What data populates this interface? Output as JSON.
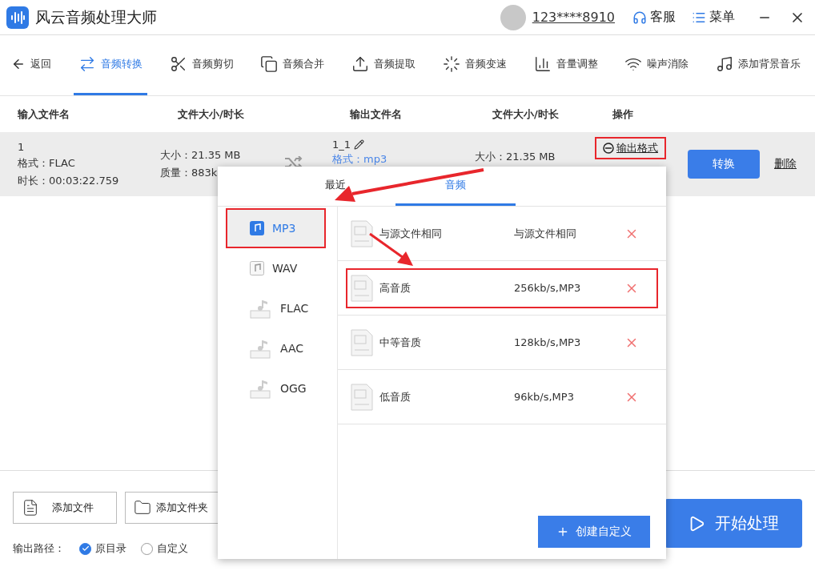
{
  "app": {
    "title": "风云音频处理大师",
    "user": "123****8910",
    "service": "客服",
    "menu": "菜单"
  },
  "nav": {
    "back": "返回",
    "tools": [
      {
        "label": "音频转换",
        "selected": true,
        "kind": "convert"
      },
      {
        "label": "音频剪切",
        "selected": false,
        "kind": "cut"
      },
      {
        "label": "音频合并",
        "selected": false,
        "kind": "merge"
      },
      {
        "label": "音频提取",
        "selected": false,
        "kind": "extract"
      },
      {
        "label": "音频变速",
        "selected": false,
        "kind": "speed"
      },
      {
        "label": "音量调整",
        "selected": false,
        "kind": "volume"
      },
      {
        "label": "噪声消除",
        "selected": false,
        "kind": "noise"
      },
      {
        "label": "添加背景音乐",
        "selected": false,
        "kind": "music"
      }
    ]
  },
  "table": {
    "columns": [
      "输入文件名",
      "文件大小/时长",
      "输出文件名",
      "文件大小/时长",
      "操作"
    ],
    "rows": [
      {
        "name": "1",
        "format": "格式：FLAC",
        "duration": "时长：00:03:22.759",
        "size": "大小：21.35 MB",
        "quality": "质量：883k",
        "output_name": "1_1",
        "output_format": "格式：mp3",
        "output_size": "大小：21.35 MB",
        "format_button": {
          "label": "输出格式",
          "highlighted": true
        },
        "convert": "转换",
        "delete": "删除"
      }
    ]
  },
  "bottom": {
    "add_file": "添加文件",
    "add_folder": "添加文件夹",
    "path_label": "输出路径：",
    "path_options": [
      {
        "label": "原目录",
        "selected": true
      },
      {
        "label": "自定义",
        "selected": false
      }
    ],
    "start": "开始处理"
  },
  "format_popup": {
    "tabs": [
      {
        "label": "最近",
        "selected": false
      },
      {
        "label": "音频",
        "selected": true
      }
    ],
    "formats": [
      {
        "label": "MP3",
        "selected": true,
        "highlighted": true,
        "kind": "square"
      },
      {
        "label": "WAV",
        "selected": false,
        "highlighted": false,
        "kind": "square"
      },
      {
        "label": "FLAC",
        "selected": false,
        "highlighted": false,
        "kind": "tagged"
      },
      {
        "label": "AAC",
        "selected": false,
        "highlighted": false,
        "kind": "tagged"
      },
      {
        "label": "OGG",
        "selected": false,
        "highlighted": false,
        "kind": "tagged"
      }
    ],
    "presets": [
      {
        "name": "与源文件相同",
        "spec": "与源文件相同",
        "highlighted": false
      },
      {
        "name": "高音质",
        "spec": "256kb/s,MP3",
        "highlighted": true
      },
      {
        "name": "中等音质",
        "spec": "128kb/s,MP3",
        "highlighted": false
      },
      {
        "name": "低音质",
        "spec": "96kb/s,MP3",
        "highlighted": false
      }
    ],
    "create": "创建自定义"
  }
}
